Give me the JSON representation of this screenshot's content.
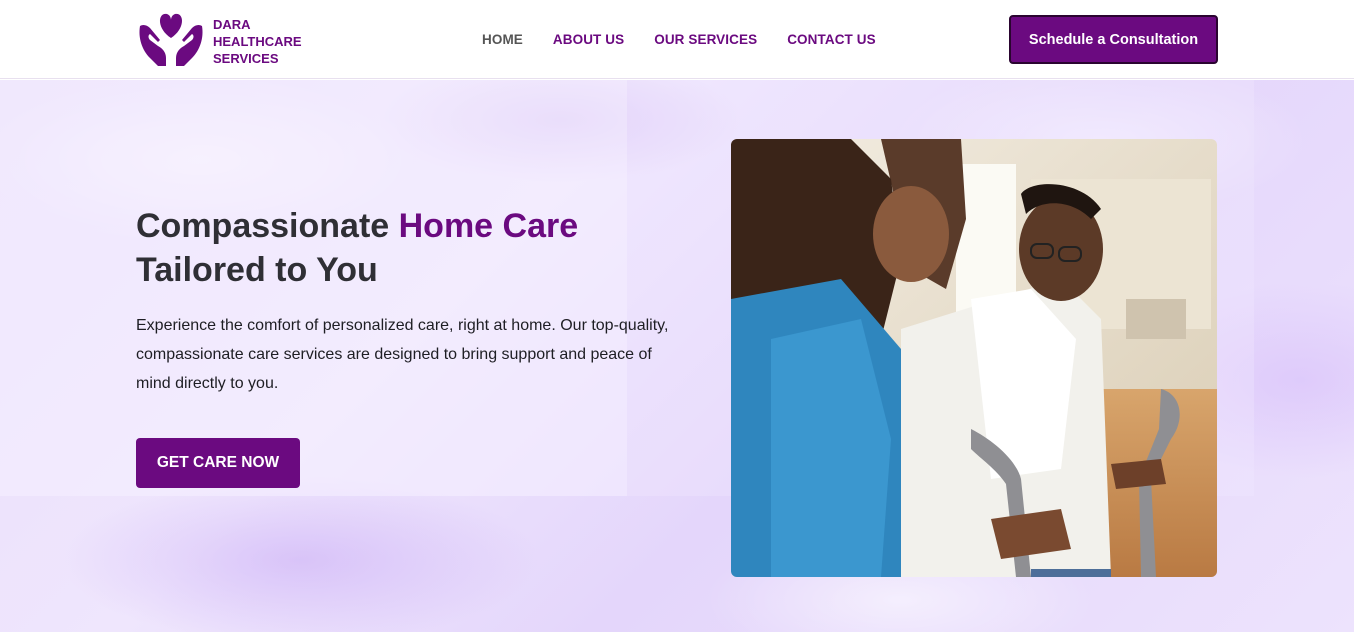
{
  "header": {
    "logo": {
      "icon": "heart-hands-icon",
      "line1": "DARA",
      "line2": "HEALTHCARE",
      "line3": "SERVICES"
    },
    "nav": [
      {
        "label": "HOME",
        "active": true
      },
      {
        "label": "ABOUT US",
        "active": false
      },
      {
        "label": "OUR SERVICES",
        "active": false
      },
      {
        "label": "CONTACT US",
        "active": false
      }
    ],
    "cta_label": "Schedule a Consultation"
  },
  "hero": {
    "title_part1": "Compassionate ",
    "title_highlight": "Home Care",
    "title_part2": "Tailored to You",
    "description": "Experience the comfort of personalized care, right at home. Our top-quality, compassionate care services are designed to bring support and peace of mind directly to you.",
    "cta_label": "GET CARE NOW",
    "image": "caregiver-helping-senior-with-crutches-photo"
  },
  "colors": {
    "brand": "#6b0a80",
    "text": "#2f2f35",
    "nav_active": "#555555",
    "hero_bg": "#ece2fc"
  }
}
